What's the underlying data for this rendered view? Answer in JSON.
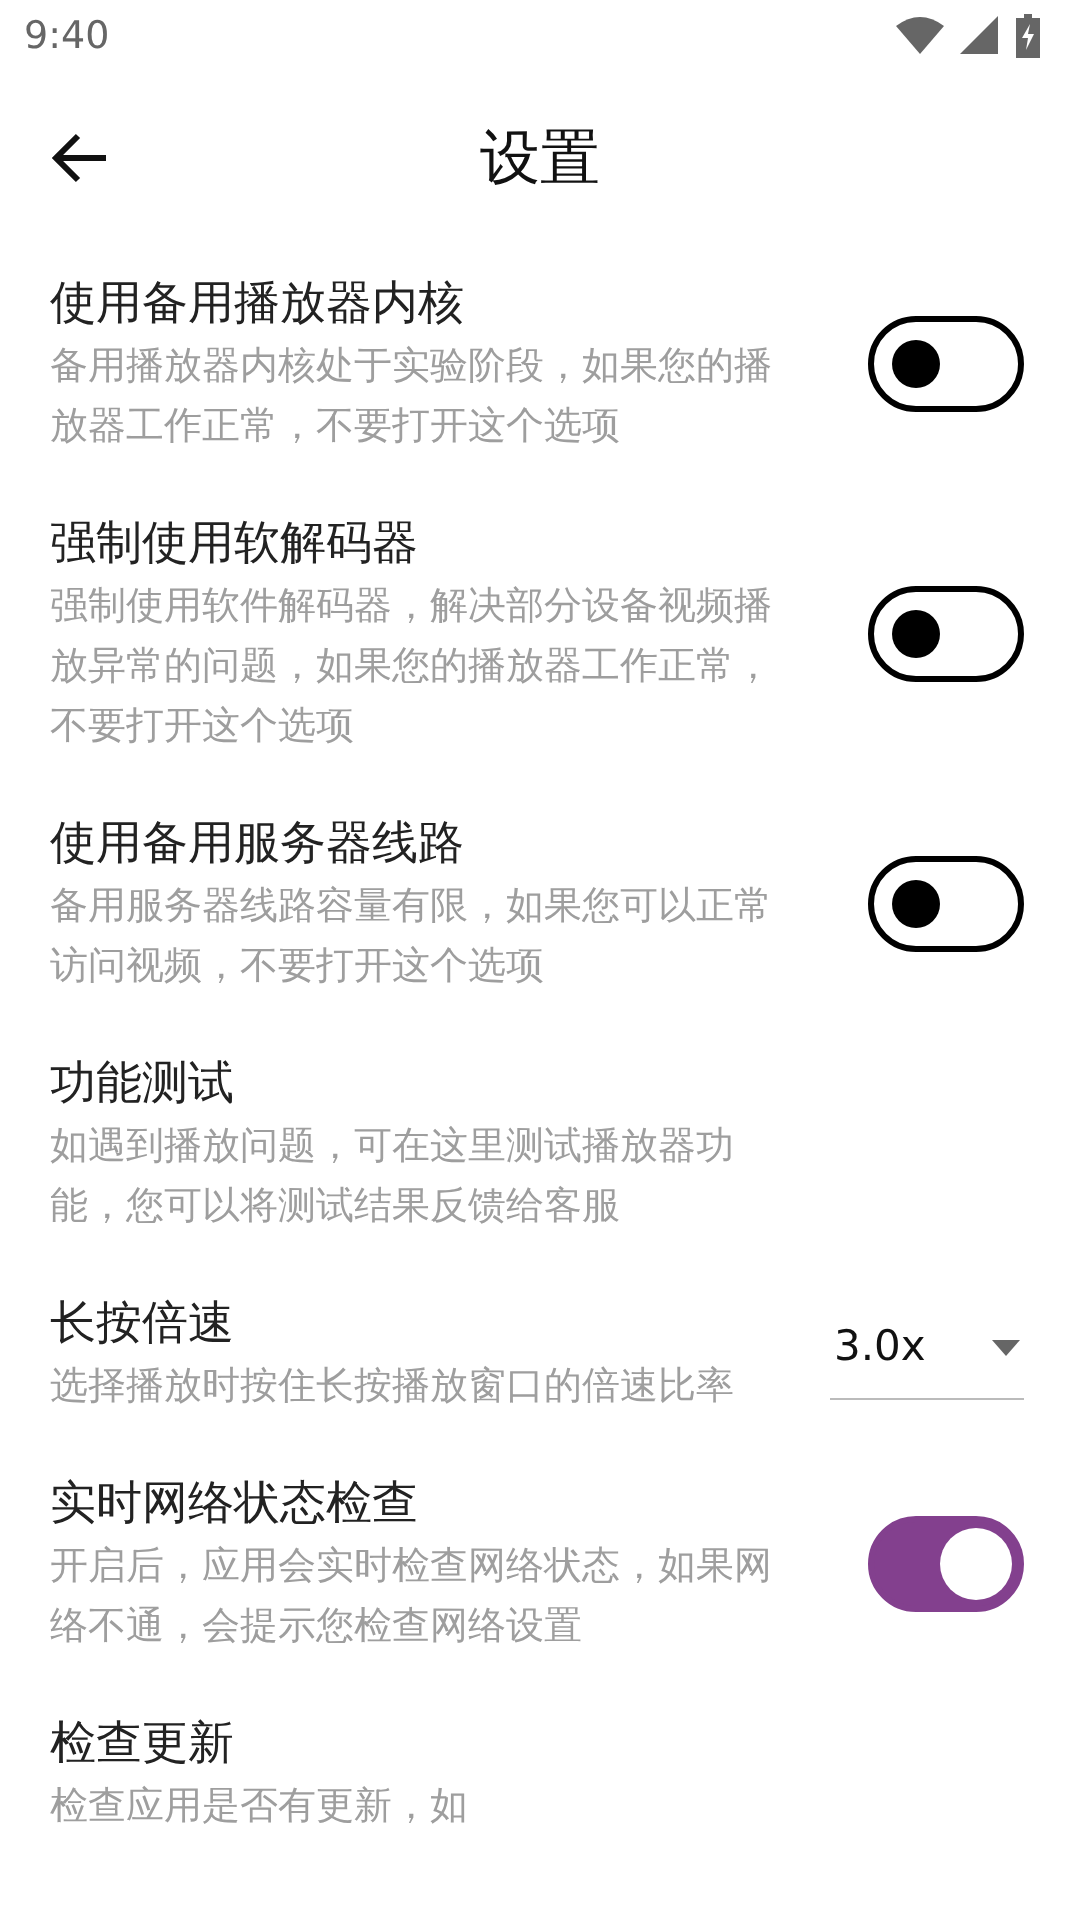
{
  "status_bar": {
    "time": "9:40"
  },
  "app_bar": {
    "title": "设置"
  },
  "settings": [
    {
      "kind": "toggle",
      "title": "使用备用播放器内核",
      "description": "备用播放器内核处于实验阶段，如果您的播放器工作正常，不要打开这个选项",
      "on": false
    },
    {
      "kind": "toggle",
      "title": "强制使用软解码器",
      "description": "强制使用软件解码器，解决部分设备视频播放异常的问题，如果您的播放器工作正常，不要打开这个选项",
      "on": false
    },
    {
      "kind": "toggle",
      "title": "使用备用服务器线路",
      "description": "备用服务器线路容量有限，如果您可以正常访问视频，不要打开这个选项",
      "on": false
    },
    {
      "kind": "plain",
      "title": "功能测试",
      "description": "如遇到播放问题，可在这里测试播放器功能，您可以将测试结果反馈给客服"
    },
    {
      "kind": "dropdown",
      "title": "长按倍速",
      "description": "选择播放时按住长按播放窗口的倍速比率",
      "value": "3.0x"
    },
    {
      "kind": "toggle",
      "title": "实时网络状态检查",
      "description": "开启后，应用会实时检查网络状态，如果网络不通，会提示您检查网络设置",
      "on": true
    },
    {
      "kind": "plain",
      "title": "检查更新",
      "description": "检查应用是否有更新，如"
    }
  ]
}
